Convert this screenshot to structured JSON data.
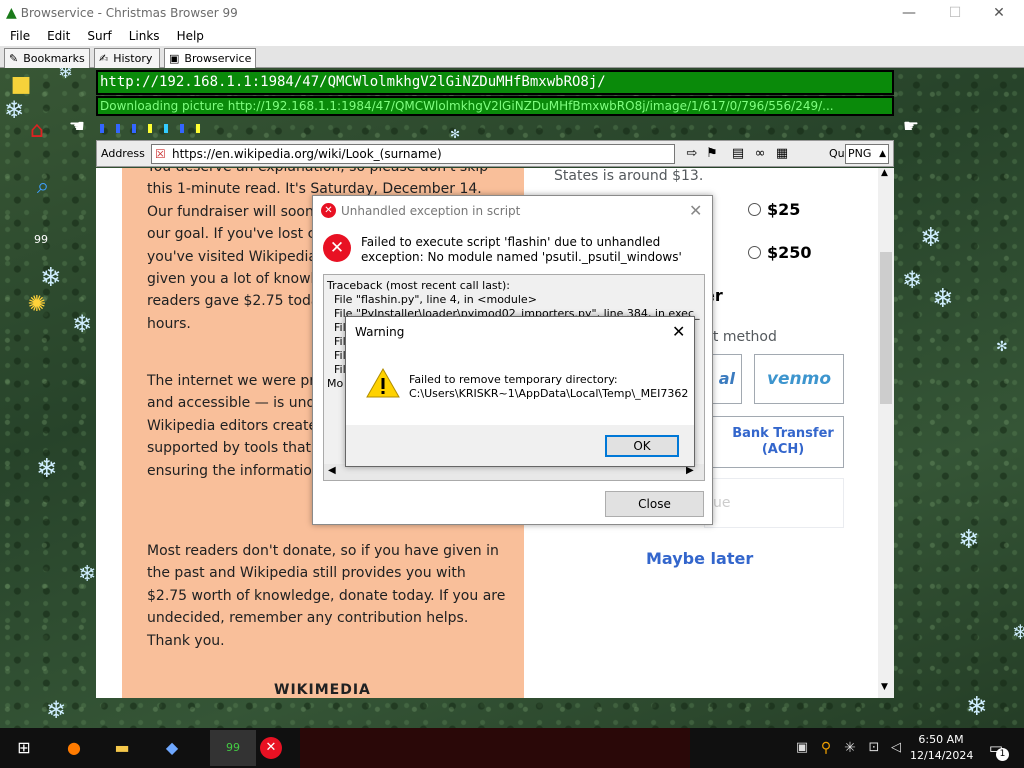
{
  "window": {
    "title": "Browservice - Christmas Browser 99"
  },
  "menu": [
    "File",
    "Edit",
    "Surf",
    "Links",
    "Help"
  ],
  "tabs": [
    {
      "label": "Bookmarks"
    },
    {
      "label": "History"
    },
    {
      "label": "Browservice"
    }
  ],
  "url_bar": {
    "value": "http://192.168.1.1:1984/47/QMCWlolmkhgV2lGiNZDuMHfBmxwbRO8j/"
  },
  "download_bar": {
    "text": "Downloading picture http://192.168.1.1:1984/47/QMCWlolmkhgV2lGiNZDuMHfBmxwbRO8j/image/1/617/0/796/556/249/..."
  },
  "address": {
    "label": "Address",
    "value": "https://en.wikipedia.org/wiki/Look_(surname)",
    "quality_label": "Quality",
    "quality_value": "PNG"
  },
  "sidebar": {
    "badge": "99"
  },
  "page": {
    "left_paras": [
      "You deserve an explanation, so please don't skip this 1-minute read. It's Saturday, December 14. Our fundraiser will soon end, and we're short of our goal. If you've lost count of how many times you've visited Wikipedia this year, that means it's given you a lot of knowledge. If just 2% of our readers gave $2.75 today, we'd reach our goal in hours.",
      "The internet we were promised — collaborative, and accessible — is under constant threat. Wikipedia editors create and verify the pages, supported by tools that work within minutes, ensuring the information is trustworthy.",
      "Most readers don't donate, so if you have given in the past and Wikipedia still provides you with $2.75 worth of knowledge, donate today. If you are undecided, remember any contribution helps. Thank you."
    ],
    "wikimedia": "WIKIMEDIA",
    "right_top": "States is around $13.",
    "amount_25": "$25",
    "amount_250": "$250",
    "partial_er": "er",
    "method_partial": "nt method",
    "pay_al": "al",
    "venmo": "venmo",
    "bank": "Bank Transfer (ACH)",
    "ue": "ue",
    "maybe_later": "Maybe later"
  },
  "error_dialog": {
    "title": "Unhandled exception in script",
    "message": "Failed to execute script 'flashin' due to unhandled exception: No module named 'psutil._psutil_windows'",
    "traceback": [
      "Traceback (most recent call last):",
      "  File \"flashin.py\", line 4, in <module>",
      "  File \"PyInstaller\\loader\\pyimod02_importers.py\", line 384, in exec_",
      "  File",
      "  File",
      "  File",
      "  File",
      "Mo"
    ],
    "close_label": "Close"
  },
  "warning_dialog": {
    "title": "Warning",
    "message": "Failed to remove temporary directory:",
    "path": "C:\\Users\\KRISKR~1\\AppData\\Local\\Temp\\_MEI7362",
    "ok_label": "OK"
  },
  "taskbar": {
    "time": "6:50 AM",
    "date": "12/14/2024",
    "badge": "99",
    "notif_count": "1"
  },
  "colors": {
    "url_bg": "#0a8a0a",
    "donate_bg": "#f9bf9a",
    "link_blue": "#3366cc",
    "error_red": "#e81123",
    "warn_yellow": "#ffd200"
  }
}
